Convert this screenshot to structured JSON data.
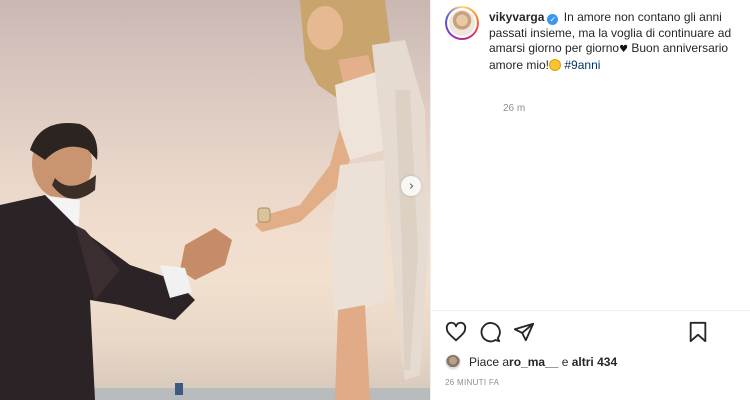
{
  "post": {
    "username": "vikyvarga",
    "verified_glyph": "✓",
    "caption_line1": "In amore non contano gli anni passati insieme, ma la voglia di continuare ad amarsi giorno per giorno",
    "heart": "♥",
    "caption_line2": " Buon anniversario amore mio!",
    "hashtag": "#9anni",
    "time_ago": "26 m",
    "likes_prefix": "Piace a ",
    "likes_user": "ro_ma__",
    "likes_middle": " e ",
    "likes_others": "altri 434",
    "timestamp": "26 MINUTI FA",
    "carousel_next": "›"
  },
  "icons": {
    "like": "heart-icon",
    "comment": "comment-icon",
    "share": "paper-plane-icon",
    "save": "bookmark-icon",
    "carousel": "chevron-right-icon"
  },
  "colors": {
    "text": "#262626",
    "muted": "#8e8e8e",
    "link": "#00376b",
    "verified": "#3897f0"
  }
}
